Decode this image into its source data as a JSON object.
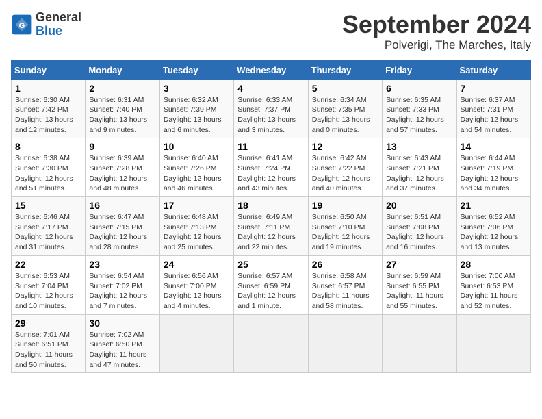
{
  "logo": {
    "text_general": "General",
    "text_blue": "Blue"
  },
  "title": "September 2024",
  "subtitle": "Polverigi, The Marches, Italy",
  "days_of_week": [
    "Sunday",
    "Monday",
    "Tuesday",
    "Wednesday",
    "Thursday",
    "Friday",
    "Saturday"
  ],
  "weeks": [
    [
      {
        "day": "1",
        "sunrise": "Sunrise: 6:30 AM",
        "sunset": "Sunset: 7:42 PM",
        "daylight": "Daylight: 13 hours and 12 minutes."
      },
      {
        "day": "2",
        "sunrise": "Sunrise: 6:31 AM",
        "sunset": "Sunset: 7:40 PM",
        "daylight": "Daylight: 13 hours and 9 minutes."
      },
      {
        "day": "3",
        "sunrise": "Sunrise: 6:32 AM",
        "sunset": "Sunset: 7:39 PM",
        "daylight": "Daylight: 13 hours and 6 minutes."
      },
      {
        "day": "4",
        "sunrise": "Sunrise: 6:33 AM",
        "sunset": "Sunset: 7:37 PM",
        "daylight": "Daylight: 13 hours and 3 minutes."
      },
      {
        "day": "5",
        "sunrise": "Sunrise: 6:34 AM",
        "sunset": "Sunset: 7:35 PM",
        "daylight": "Daylight: 13 hours and 0 minutes."
      },
      {
        "day": "6",
        "sunrise": "Sunrise: 6:35 AM",
        "sunset": "Sunset: 7:33 PM",
        "daylight": "Daylight: 12 hours and 57 minutes."
      },
      {
        "day": "7",
        "sunrise": "Sunrise: 6:37 AM",
        "sunset": "Sunset: 7:31 PM",
        "daylight": "Daylight: 12 hours and 54 minutes."
      }
    ],
    [
      {
        "day": "8",
        "sunrise": "Sunrise: 6:38 AM",
        "sunset": "Sunset: 7:30 PM",
        "daylight": "Daylight: 12 hours and 51 minutes."
      },
      {
        "day": "9",
        "sunrise": "Sunrise: 6:39 AM",
        "sunset": "Sunset: 7:28 PM",
        "daylight": "Daylight: 12 hours and 48 minutes."
      },
      {
        "day": "10",
        "sunrise": "Sunrise: 6:40 AM",
        "sunset": "Sunset: 7:26 PM",
        "daylight": "Daylight: 12 hours and 46 minutes."
      },
      {
        "day": "11",
        "sunrise": "Sunrise: 6:41 AM",
        "sunset": "Sunset: 7:24 PM",
        "daylight": "Daylight: 12 hours and 43 minutes."
      },
      {
        "day": "12",
        "sunrise": "Sunrise: 6:42 AM",
        "sunset": "Sunset: 7:22 PM",
        "daylight": "Daylight: 12 hours and 40 minutes."
      },
      {
        "day": "13",
        "sunrise": "Sunrise: 6:43 AM",
        "sunset": "Sunset: 7:21 PM",
        "daylight": "Daylight: 12 hours and 37 minutes."
      },
      {
        "day": "14",
        "sunrise": "Sunrise: 6:44 AM",
        "sunset": "Sunset: 7:19 PM",
        "daylight": "Daylight: 12 hours and 34 minutes."
      }
    ],
    [
      {
        "day": "15",
        "sunrise": "Sunrise: 6:46 AM",
        "sunset": "Sunset: 7:17 PM",
        "daylight": "Daylight: 12 hours and 31 minutes."
      },
      {
        "day": "16",
        "sunrise": "Sunrise: 6:47 AM",
        "sunset": "Sunset: 7:15 PM",
        "daylight": "Daylight: 12 hours and 28 minutes."
      },
      {
        "day": "17",
        "sunrise": "Sunrise: 6:48 AM",
        "sunset": "Sunset: 7:13 PM",
        "daylight": "Daylight: 12 hours and 25 minutes."
      },
      {
        "day": "18",
        "sunrise": "Sunrise: 6:49 AM",
        "sunset": "Sunset: 7:11 PM",
        "daylight": "Daylight: 12 hours and 22 minutes."
      },
      {
        "day": "19",
        "sunrise": "Sunrise: 6:50 AM",
        "sunset": "Sunset: 7:10 PM",
        "daylight": "Daylight: 12 hours and 19 minutes."
      },
      {
        "day": "20",
        "sunrise": "Sunrise: 6:51 AM",
        "sunset": "Sunset: 7:08 PM",
        "daylight": "Daylight: 12 hours and 16 minutes."
      },
      {
        "day": "21",
        "sunrise": "Sunrise: 6:52 AM",
        "sunset": "Sunset: 7:06 PM",
        "daylight": "Daylight: 12 hours and 13 minutes."
      }
    ],
    [
      {
        "day": "22",
        "sunrise": "Sunrise: 6:53 AM",
        "sunset": "Sunset: 7:04 PM",
        "daylight": "Daylight: 12 hours and 10 minutes."
      },
      {
        "day": "23",
        "sunrise": "Sunrise: 6:54 AM",
        "sunset": "Sunset: 7:02 PM",
        "daylight": "Daylight: 12 hours and 7 minutes."
      },
      {
        "day": "24",
        "sunrise": "Sunrise: 6:56 AM",
        "sunset": "Sunset: 7:00 PM",
        "daylight": "Daylight: 12 hours and 4 minutes."
      },
      {
        "day": "25",
        "sunrise": "Sunrise: 6:57 AM",
        "sunset": "Sunset: 6:59 PM",
        "daylight": "Daylight: 12 hours and 1 minute."
      },
      {
        "day": "26",
        "sunrise": "Sunrise: 6:58 AM",
        "sunset": "Sunset: 6:57 PM",
        "daylight": "Daylight: 11 hours and 58 minutes."
      },
      {
        "day": "27",
        "sunrise": "Sunrise: 6:59 AM",
        "sunset": "Sunset: 6:55 PM",
        "daylight": "Daylight: 11 hours and 55 minutes."
      },
      {
        "day": "28",
        "sunrise": "Sunrise: 7:00 AM",
        "sunset": "Sunset: 6:53 PM",
        "daylight": "Daylight: 11 hours and 52 minutes."
      }
    ],
    [
      {
        "day": "29",
        "sunrise": "Sunrise: 7:01 AM",
        "sunset": "Sunset: 6:51 PM",
        "daylight": "Daylight: 11 hours and 50 minutes."
      },
      {
        "day": "30",
        "sunrise": "Sunrise: 7:02 AM",
        "sunset": "Sunset: 6:50 PM",
        "daylight": "Daylight: 11 hours and 47 minutes."
      },
      null,
      null,
      null,
      null,
      null
    ]
  ]
}
